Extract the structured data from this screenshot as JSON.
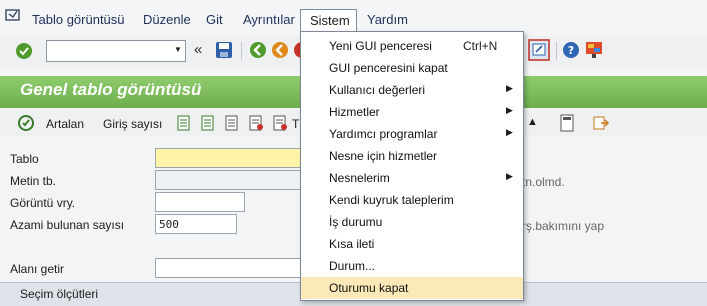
{
  "menubar": {
    "items": [
      "Tablo görüntüsü",
      "Düzenle",
      "Git",
      "Ayrıntılar",
      "Sistem",
      "Yardım"
    ]
  },
  "toolbar": {
    "command_value": ""
  },
  "titlebar": {
    "title": "Genel tablo görüntüsü"
  },
  "apptoolbar": {
    "artalan": "Artalan",
    "giris": "Giriş sayısı"
  },
  "form": {
    "tablo": "Tablo",
    "metin": "Metin tb.",
    "goruntu": "Görüntü vry.",
    "azami": "Azami bulunan sayısı",
    "azami_value": "500",
    "alani": "Alanı getir",
    "right_text_1": "tn.olmd.",
    "right_text_2": "rş.bakımını yap",
    "selection": "Seçim ölçütleri"
  },
  "dropdown": {
    "items": [
      {
        "label": "Yeni GUI penceresi",
        "shortcut": "Ctrl+N",
        "arrow": ""
      },
      {
        "label": "GUI penceresini kapat",
        "shortcut": "",
        "arrow": ""
      },
      {
        "label": "Kullanıcı değerleri",
        "shortcut": "",
        "arrow": "▶"
      },
      {
        "label": "Hizmetler",
        "shortcut": "",
        "arrow": "▶"
      },
      {
        "label": "Yardımcı programlar",
        "shortcut": "",
        "arrow": "▶"
      },
      {
        "label": "Nesne için hizmetler",
        "shortcut": "",
        "arrow": ""
      },
      {
        "label": "Nesnelerim",
        "shortcut": "",
        "arrow": "▶"
      },
      {
        "label": "Kendi kuyruk taleplerim",
        "shortcut": "",
        "arrow": ""
      },
      {
        "label": "İş durumu",
        "shortcut": "",
        "arrow": ""
      },
      {
        "label": "Kısa ileti",
        "shortcut": "",
        "arrow": ""
      },
      {
        "label": "Durum...",
        "shortcut": "",
        "arrow": ""
      },
      {
        "label": "Oturumu kapat",
        "shortcut": "",
        "arrow": ""
      }
    ],
    "highlighted_index": 11
  },
  "colors": {
    "accent": "#6fae4f",
    "highlight": "#fbe9b7"
  }
}
